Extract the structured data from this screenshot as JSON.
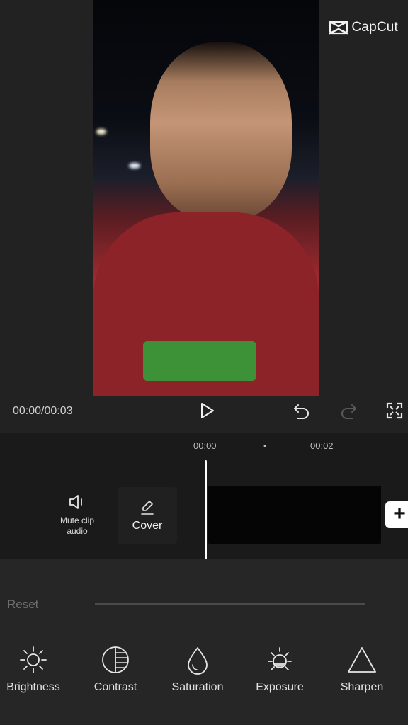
{
  "app": {
    "watermark": "CapCut"
  },
  "player": {
    "timecode": "00:00/00:03"
  },
  "timeline": {
    "ruler": [
      "00:00",
      "•",
      "00:02"
    ],
    "mute_clip_label": "Mute clip audio",
    "cover_label": "Cover",
    "add_symbol": "+"
  },
  "adjust": {
    "reset_label": "Reset",
    "tools": [
      {
        "label": "Brightness",
        "icon": "sun-icon"
      },
      {
        "label": "Contrast",
        "icon": "contrast-icon"
      },
      {
        "label": "Saturation",
        "icon": "droplet-icon"
      },
      {
        "label": "Exposure",
        "icon": "exposure-icon"
      },
      {
        "label": "Sharpen",
        "icon": "triangle-icon"
      }
    ]
  },
  "colors": {
    "background": "#1b1b1b",
    "panel": "#262626",
    "playhead": "#ffffff",
    "muted_text": "#6f6f6f"
  }
}
